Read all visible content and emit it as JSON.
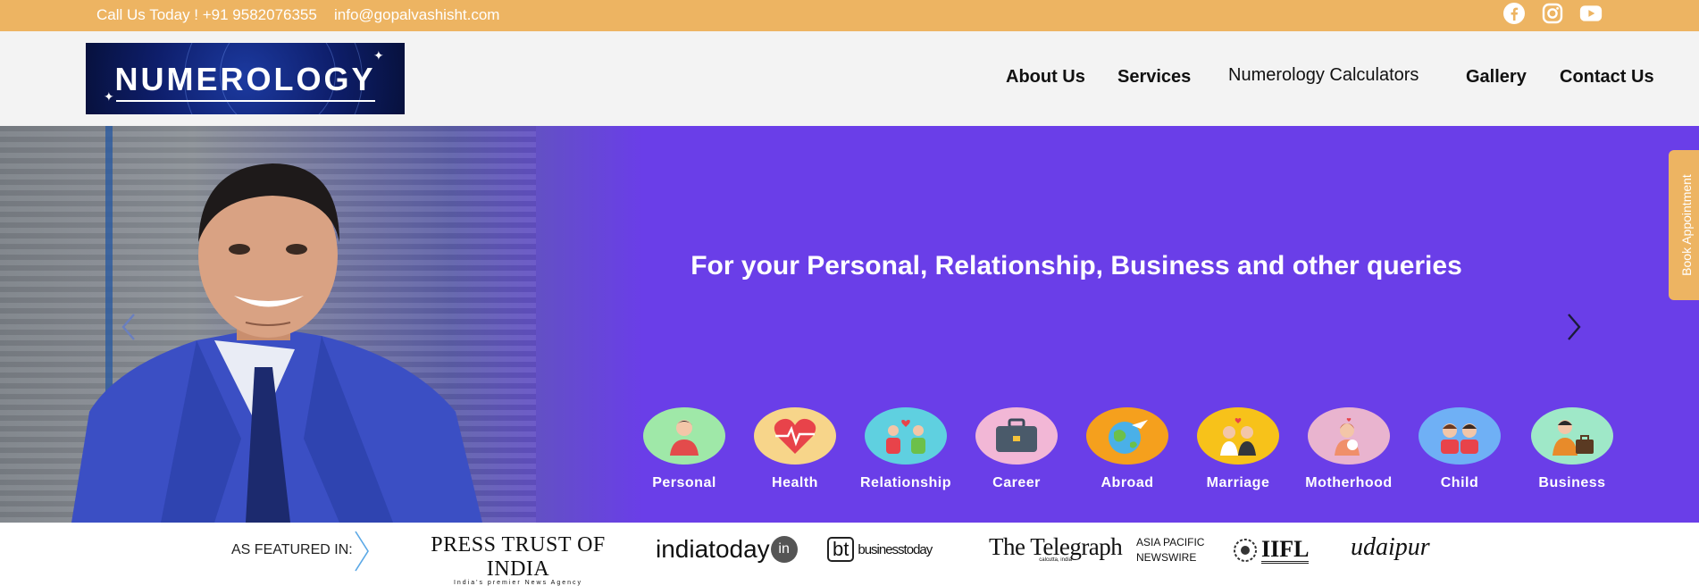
{
  "topbar": {
    "phone": "Call Us Today ! +91 9582076355",
    "email": "info@gopalvashisht.com",
    "social": [
      "facebook-icon",
      "instagram-icon",
      "youtube-icon"
    ]
  },
  "header": {
    "logo_text": "NUMEROLOGY",
    "nav": [
      "About Us",
      "Services",
      "Numerology Calculators",
      "Gallery",
      "Contact Us"
    ]
  },
  "hero": {
    "headline": "For your Personal, Relationship, Business and other queries",
    "categories": [
      {
        "label": "Personal",
        "color": "#9fe8a8"
      },
      {
        "label": "Health",
        "color": "#f7d58a"
      },
      {
        "label": "Relationship",
        "color": "#5fd0e0"
      },
      {
        "label": "Career",
        "color": "#f2b7d6"
      },
      {
        "label": "Abroad",
        "color": "#f5a01d"
      },
      {
        "label": "Marriage",
        "color": "#f7c21a"
      },
      {
        "label": "Motherhood",
        "color": "#e9b4cf"
      },
      {
        "label": "Child",
        "color": "#6fb0f5"
      },
      {
        "label": "Business",
        "color": "#9fe8c8"
      }
    ],
    "book_button": "Book Appointment"
  },
  "featured": {
    "label": "AS FEATURED IN:",
    "media": [
      "PRESS TRUST OF INDIA",
      "India's premier News Agency",
      "indiatoday",
      "in",
      "bt",
      "businesstoday",
      "The Telegraph",
      "calcutta, india",
      "ASIA PACIFIC",
      "NEWSWIRE",
      "IIFL",
      "udaipur"
    ]
  },
  "colors": {
    "topbar": "#edb462",
    "hero": "#6a3ee8",
    "header": "#f3f3f3"
  }
}
